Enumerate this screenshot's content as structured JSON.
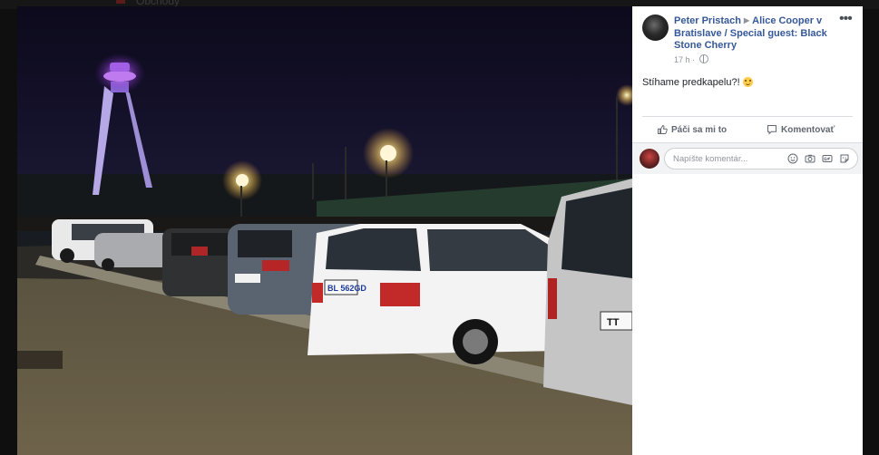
{
  "top_strip": {
    "text": "Obchody"
  },
  "post": {
    "author": "Peter Pristach",
    "event": "Alice Cooper v Bratislave / Special guest: Black Stone Cherry",
    "time": "17 h",
    "text": "Stíhame predkapelu?!",
    "license_plate_1": "BL 562GD",
    "license_plate_2": "TT"
  },
  "actions": {
    "like": "Páči sa mi to",
    "comment": "Komentovať"
  },
  "comment_box": {
    "placeholder": "Napíšte komentár..."
  },
  "icons": {
    "more": "more-options-icon",
    "like": "thumbs-up-icon",
    "comment": "speech-bubble-icon",
    "emoji": "smiley-icon",
    "camera": "camera-icon",
    "gif": "gif-icon",
    "sticker": "sticker-icon",
    "privacy": "globe-icon"
  },
  "colors": {
    "link": "#365899",
    "meta": "#90949c",
    "action": "#606770"
  }
}
